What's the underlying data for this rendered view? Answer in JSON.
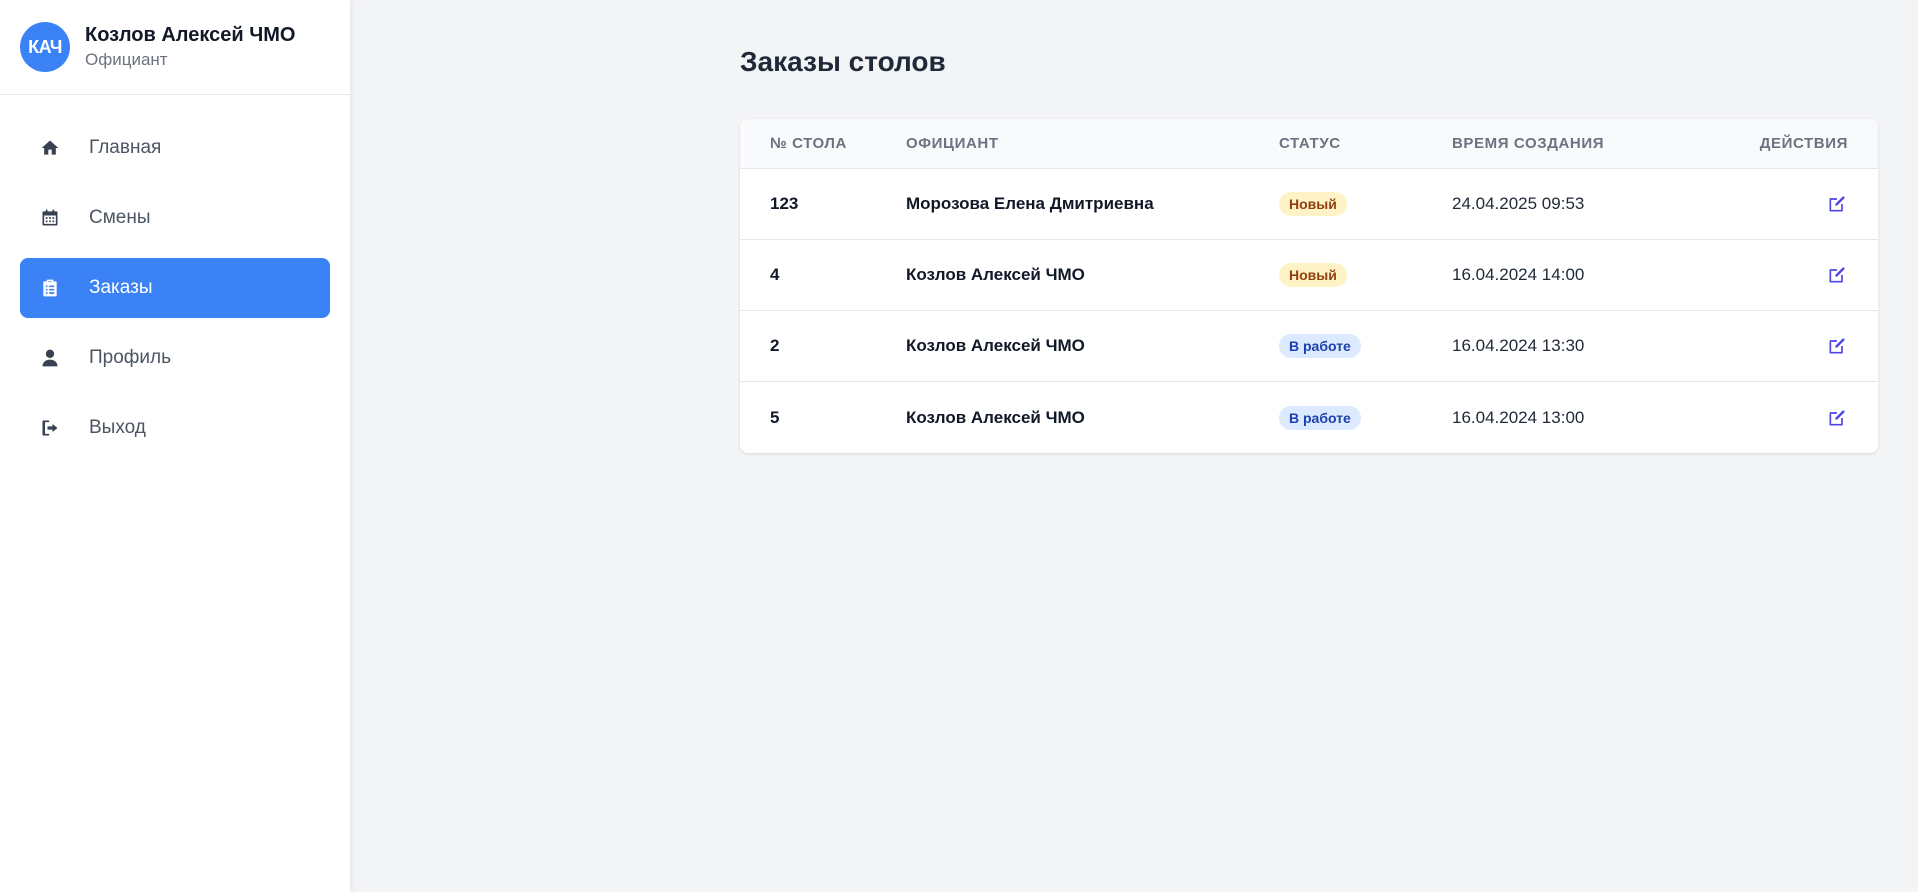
{
  "user": {
    "initials": "КАЧ",
    "name": "Козлов Алексей ЧМО",
    "role": "Официант"
  },
  "nav": {
    "items": [
      {
        "label": "Главная",
        "icon": "home-icon"
      },
      {
        "label": "Смены",
        "icon": "calendar-icon"
      },
      {
        "label": "Заказы",
        "icon": "clipboard-icon",
        "active": true
      },
      {
        "label": "Профиль",
        "icon": "user-icon"
      },
      {
        "label": "Выход",
        "icon": "logout-icon"
      }
    ]
  },
  "page": {
    "title": "Заказы столов"
  },
  "table": {
    "headers": [
      "№ стола",
      "Официант",
      "Статус",
      "Время создания",
      "Действия"
    ],
    "rows": [
      {
        "table_no": "123",
        "waiter": "Морозова Елена Дмитриевна",
        "status": "Новый",
        "status_type": "new",
        "created": "24.04.2025 09:53"
      },
      {
        "table_no": "4",
        "waiter": "Козлов Алексей ЧМО",
        "status": "Новый",
        "status_type": "new",
        "created": "16.04.2024 14:00"
      },
      {
        "table_no": "2",
        "waiter": "Козлов Алексей ЧМО",
        "status": "В работе",
        "status_type": "work",
        "created": "16.04.2024 13:30"
      },
      {
        "table_no": "5",
        "waiter": "Козлов Алексей ЧМО",
        "status": "В работе",
        "status_type": "work",
        "created": "16.04.2024 13:00"
      }
    ]
  },
  "colors": {
    "accent": "#3b82f6",
    "badge_new_bg": "#fef3c7",
    "badge_work_bg": "#dbeafe",
    "edit_icon": "#4f46e5"
  }
}
